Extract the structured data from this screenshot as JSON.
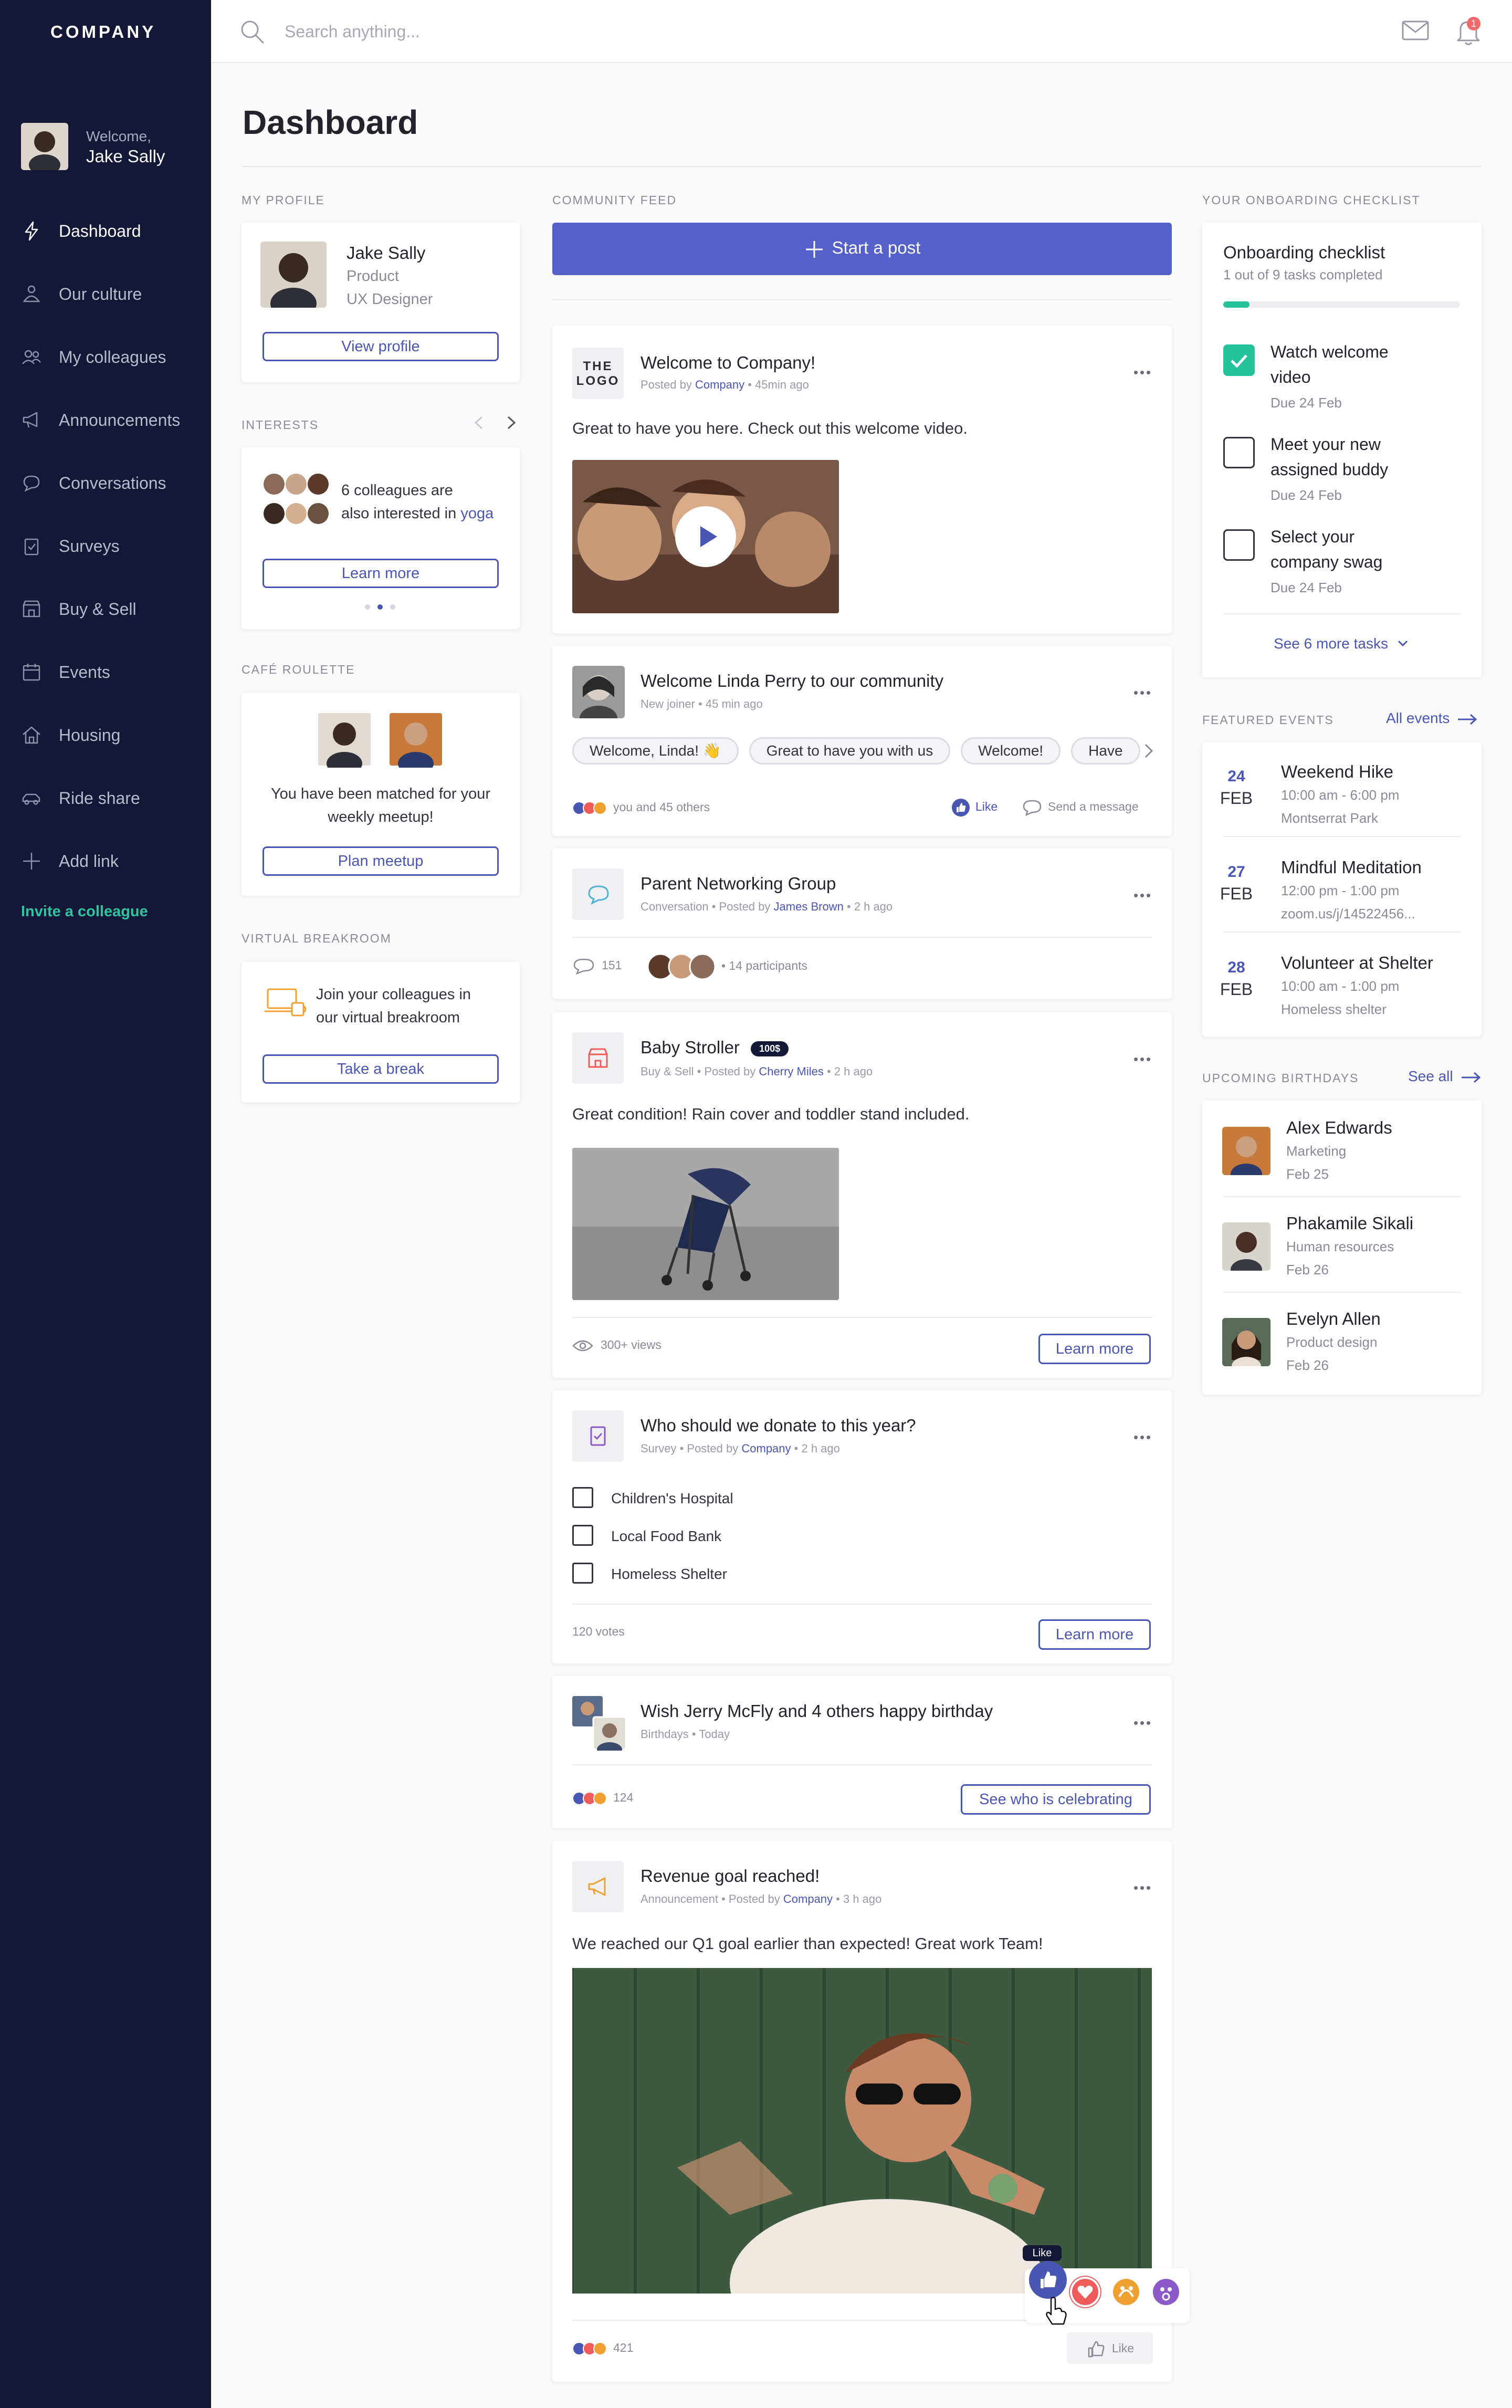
{
  "brand": {
    "name": "COMPANY",
    "accent": "#4a56b4",
    "sidebar_bg": "#141735",
    "success": "#24c29a"
  },
  "user": {
    "welcome": "Welcome,",
    "name": "Jake Sally"
  },
  "nav": [
    {
      "label": "Dashboard",
      "icon": "bolt-icon"
    },
    {
      "label": "Our culture",
      "icon": "culture-icon"
    },
    {
      "label": "My colleagues",
      "icon": "people-icon"
    },
    {
      "label": "Announcements",
      "icon": "megaphone-icon"
    },
    {
      "label": "Conversations",
      "icon": "chat-icon"
    },
    {
      "label": "Surveys",
      "icon": "clipboard-icon"
    },
    {
      "label": "Buy & Sell",
      "icon": "store-icon"
    },
    {
      "label": "Events",
      "icon": "calendar-icon"
    },
    {
      "label": "Housing",
      "icon": "house-icon"
    },
    {
      "label": "Ride share",
      "icon": "car-icon"
    },
    {
      "label": "Add link",
      "icon": "plus-icon"
    }
  ],
  "invite": "Invite a colleague",
  "search": {
    "placeholder": "Search anything..."
  },
  "notifications": {
    "count": "1"
  },
  "page_title": "Dashboard",
  "profile": {
    "section": "MY PROFILE",
    "name": "Jake Sally",
    "dept": "Product",
    "role": "UX Designer",
    "button": "View profile"
  },
  "interests": {
    "section": "INTERESTS",
    "line1": "6 colleagues are",
    "line2": "also interested in",
    "interest": "yoga",
    "button": "Learn more"
  },
  "cafe": {
    "section": "CAFÉ ROULETTE",
    "line1": "You have been matched for your",
    "line2": "weekly meetup!",
    "button": "Plan meetup"
  },
  "breakroom": {
    "section": "VIRTUAL BREAKROOM",
    "line1": "Join your colleagues in",
    "line2": "our virtual breakroom",
    "button": "Take a break"
  },
  "feed": {
    "section": "COMMUNITY FEED",
    "start_post": "Start a post",
    "welcome": {
      "logo1": "THE",
      "logo2": "LOGO",
      "title": "Welcome to Company!",
      "meta_pre": "Posted by",
      "author": "Company",
      "time": "• 45min ago",
      "body": "Great to have you here. Check out this welcome video."
    },
    "joiner": {
      "title": "Welcome Linda Perry to our community",
      "meta": "New joiner • 45 min ago",
      "chips": [
        "Welcome, Linda! 👋",
        "Great to have you with us",
        "Welcome!",
        "Have"
      ],
      "reactions": "you and 45 others",
      "like": "Like",
      "message": "Send a message"
    },
    "group": {
      "title": "Parent Networking Group",
      "meta_pre": "Conversation • Posted by",
      "author": "James Brown",
      "time": "• 2 h ago",
      "comments": "151",
      "participants": "• 14 participants"
    },
    "stroller": {
      "title": "Baby Stroller",
      "price": "100$",
      "meta_pre": "Buy & Sell • Posted by",
      "author": "Cherry Miles",
      "time": "• 2 h ago",
      "body": "Great condition! Rain cover and toddler stand included.",
      "views": "300+ views",
      "button": "Learn more"
    },
    "survey": {
      "title": "Who should we donate to this year?",
      "meta_pre": "Survey • Posted by",
      "author": "Company",
      "time": "• 2 h ago",
      "options": [
        "Children's Hospital",
        "Local Food Bank",
        "Homeless Shelter"
      ],
      "votes": "120 votes",
      "button": "Learn more"
    },
    "birthday": {
      "title": "Wish Jerry McFly and 4 others happy birthday",
      "meta": "Birthdays • Today",
      "count": "124",
      "button": "See who is celebrating"
    },
    "revenue": {
      "title": "Revenue goal reached!",
      "meta_pre": "Announcement • Posted by",
      "author": "Company",
      "time": "• 3 h ago",
      "body": "We reached our Q1 goal earlier than expected! Great work Team!",
      "count": "421",
      "like": "Like",
      "tooltip": "Like"
    }
  },
  "onboarding": {
    "section": "YOUR ONBOARDING CHECKLIST",
    "title": "Onboarding checklist",
    "progress_text": "1 out of 9 tasks completed",
    "progress": 0.11,
    "tasks": [
      {
        "l1": "Watch welcome",
        "l2": "video",
        "due": "Due 24 Feb",
        "done": true
      },
      {
        "l1": "Meet your new",
        "l2": "assigned buddy",
        "due": "Due 24 Feb",
        "done": false
      },
      {
        "l1": "Select your",
        "l2": "company swag",
        "due": "Due 24 Feb",
        "done": false
      }
    ],
    "more": "See 6 more tasks"
  },
  "events": {
    "section": "FEATURED EVENTS",
    "all": "All events",
    "items": [
      {
        "day": "24",
        "month": "FEB",
        "title": "Weekend Hike",
        "time": "10:00 am - 6:00 pm",
        "place": "Montserrat Park"
      },
      {
        "day": "27",
        "month": "FEB",
        "title": "Mindful Meditation",
        "time": "12:00 pm - 1:00 pm",
        "place": "zoom.us/j/14522456..."
      },
      {
        "day": "28",
        "month": "FEB",
        "title": "Volunteer at Shelter",
        "time": "10:00 am - 1:00 pm",
        "place": "Homeless shelter"
      }
    ]
  },
  "birthdays": {
    "section": "UPCOMING BIRTHDAYS",
    "all": "See all",
    "items": [
      {
        "name": "Alex Edwards",
        "dept": "Marketing",
        "date": "Feb 25"
      },
      {
        "name": "Phakamile Sikali",
        "dept": "Human resources",
        "date": "Feb 26"
      },
      {
        "name": "Evelyn Allen",
        "dept": "Product design",
        "date": "Feb 26"
      }
    ]
  }
}
